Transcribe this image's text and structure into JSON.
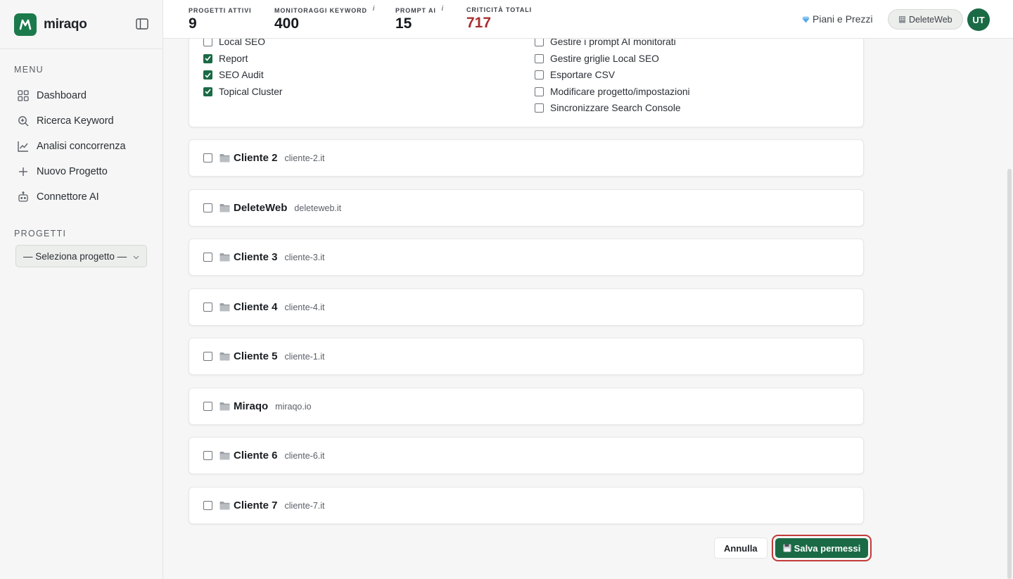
{
  "brand": {
    "name": "miraqo",
    "accent": "#1b7a4b"
  },
  "sidebar": {
    "menu_label": "MENU",
    "items": [
      {
        "label": "Dashboard",
        "icon": "dashboard-grid-icon"
      },
      {
        "label": "Ricerca Keyword",
        "icon": "search-icon"
      },
      {
        "label": "Analisi concorrenza",
        "icon": "line-chart-icon"
      },
      {
        "label": "Nuovo Progetto",
        "icon": "plus-icon"
      },
      {
        "label": "Connettore AI",
        "icon": "robot-icon"
      }
    ],
    "projects_label": "PROGETTI",
    "project_select": "— Seleziona progetto —"
  },
  "stats": [
    {
      "label": "PROGETTI ATTIVI",
      "value": "9",
      "info": ""
    },
    {
      "label": "MONITORAGGI KEYWORD",
      "value": "400",
      "info": "i"
    },
    {
      "label": "PROMPT AI",
      "value": "15",
      "info": "i"
    },
    {
      "label": "CRITICITÀ TOTALI",
      "value": "717",
      "info": ""
    }
  ],
  "header": {
    "plans_label": "Piani e Prezzi",
    "org_label": "DeleteWeb",
    "avatar_initials": "UT"
  },
  "permissions": {
    "left": [
      {
        "label": "Local SEO",
        "checked": false
      },
      {
        "label": "Report",
        "checked": true
      },
      {
        "label": "SEO Audit",
        "checked": true
      },
      {
        "label": "Topical Cluster",
        "checked": true
      }
    ],
    "right": [
      {
        "label": "Gestire i prompt AI monitorati",
        "checked": false
      },
      {
        "label": "Gestire griglie Local SEO",
        "checked": false
      },
      {
        "label": "Esportare CSV",
        "checked": false
      },
      {
        "label": "Modificare progetto/impostazioni",
        "checked": false
      },
      {
        "label": "Sincronizzare Search Console",
        "checked": false
      }
    ]
  },
  "projects": [
    {
      "name": "Cliente 2",
      "domain": "cliente-2.it"
    },
    {
      "name": "DeleteWeb",
      "domain": "deleteweb.it"
    },
    {
      "name": "Cliente 3",
      "domain": "cliente-3.it"
    },
    {
      "name": "Cliente 4",
      "domain": "cliente-4.it"
    },
    {
      "name": "Cliente 5",
      "domain": "cliente-1.it"
    },
    {
      "name": "Miraqo",
      "domain": "miraqo.io"
    },
    {
      "name": "Cliente 6",
      "domain": "cliente-6.it"
    },
    {
      "name": "Cliente 7",
      "domain": "cliente-7.it"
    }
  ],
  "actions": {
    "cancel_label": "Annulla",
    "save_label": "Salva permessi"
  }
}
